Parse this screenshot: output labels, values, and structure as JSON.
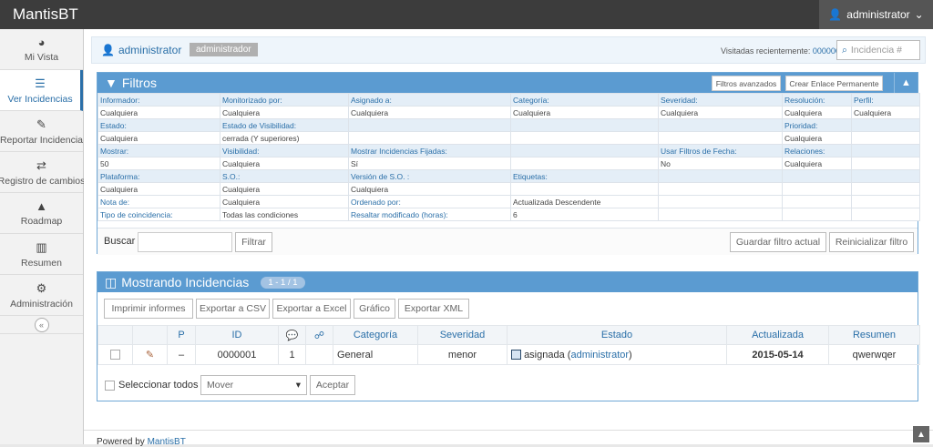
{
  "app": {
    "brand": "MantisBT",
    "user_menu": "administrator"
  },
  "sidebar": {
    "items": [
      {
        "label": "Mi Vista",
        "icon": "dashboard-icon",
        "glyph": "◕"
      },
      {
        "label": "Ver Incidencias",
        "icon": "list-icon",
        "glyph": "☰"
      },
      {
        "label": "Reportar Incidencia",
        "icon": "edit-icon",
        "glyph": "✎"
      },
      {
        "label": "Registro de cambios",
        "icon": "retweet-icon",
        "glyph": "⇄"
      },
      {
        "label": "Roadmap",
        "icon": "road-icon",
        "glyph": "▲"
      },
      {
        "label": "Resumen",
        "icon": "bar-chart-icon",
        "glyph": "▥"
      },
      {
        "label": "Administración",
        "icon": "gears-icon",
        "glyph": "⚙"
      }
    ],
    "collapse": "«"
  },
  "userbar": {
    "user": "administrator",
    "role": "administrador",
    "recent_label": "Visitadas recientemente:",
    "recent_id": "0000001",
    "search_placeholder": "Incidencia #"
  },
  "filters": {
    "title": "Filtros",
    "advanced": "Filtros avanzados",
    "permalink": "Crear Enlace Permanente",
    "rows": [
      {
        "type": "lab",
        "cells": [
          "Informador:",
          "Monitorizado por:",
          "Asignado a:",
          "Categoría:",
          "Severidad:",
          "Resolución:",
          "Perfil:"
        ]
      },
      {
        "type": "val",
        "cells": [
          "Cualquiera",
          "Cualquiera",
          "Cualquiera",
          "Cualquiera",
          "Cualquiera",
          "Cualquiera",
          "Cualquiera"
        ]
      },
      {
        "type": "lab",
        "cells": [
          "Estado:",
          "Estado de Visibilidad:",
          "",
          "",
          "",
          "Prioridad:",
          ""
        ]
      },
      {
        "type": "val",
        "cells": [
          "Cualquiera",
          "cerrada (Y superiores)",
          "",
          "",
          "",
          "Cualquiera",
          ""
        ]
      },
      {
        "type": "lab",
        "cells": [
          "Mostrar:",
          "Visibilidad:",
          "Mostrar Incidencias Fijadas:",
          "",
          "Usar Filtros de Fecha:",
          "Relaciones:",
          ""
        ]
      },
      {
        "type": "val",
        "cells": [
          "50",
          "Cualquiera",
          "Sí",
          "",
          "No",
          "Cualquiera",
          ""
        ]
      },
      {
        "type": "lab",
        "cells": [
          "Plataforma:",
          "S.O.:",
          "Versión de S.O. :",
          "Etiquetas:",
          "",
          "",
          ""
        ]
      },
      {
        "type": "val",
        "cells": [
          "Cualquiera",
          "Cualquiera",
          "Cualquiera",
          "",
          "",
          "",
          ""
        ]
      },
      {
        "type": "val",
        "cells": [
          "Nota de:",
          "Cualquiera",
          "Ordenado por:",
          "Actualizada Descendente",
          "",
          "",
          ""
        ]
      },
      {
        "type": "val",
        "cells": [
          "Tipo de coincidencia:",
          "Todas las condiciones",
          "Resaltar modificado (horas):",
          "6",
          "",
          "",
          ""
        ]
      }
    ],
    "search_label": "Buscar",
    "filter_btn": "Filtrar",
    "save_btn": "Guardar filtro actual",
    "reset_btn": "Reinicializar filtro"
  },
  "results": {
    "title": "Mostrando Incidencias",
    "count": "1 - 1 / 1",
    "toolbar": [
      "Imprimir informes",
      "Exportar a CSV",
      "Exportar a Excel",
      "Gráfico",
      "Exportar XML"
    ],
    "headers": [
      "",
      "",
      "P",
      "ID",
      "☍",
      "",
      "Categoría",
      "Severidad",
      "Estado",
      "Actualizada",
      "Resumen"
    ],
    "row": {
      "priority": "–",
      "id": "0000001",
      "notes": "1",
      "category": "General",
      "severity": "menor",
      "status": "asignada",
      "assignee": "administrator",
      "updated": "2015-05-14",
      "summary": "qwerwqer"
    },
    "select_all": "Seleccionar todos",
    "move": "Mover",
    "accept": "Aceptar"
  },
  "footer": {
    "powered": "Powered by",
    "link": "MantisBT"
  }
}
